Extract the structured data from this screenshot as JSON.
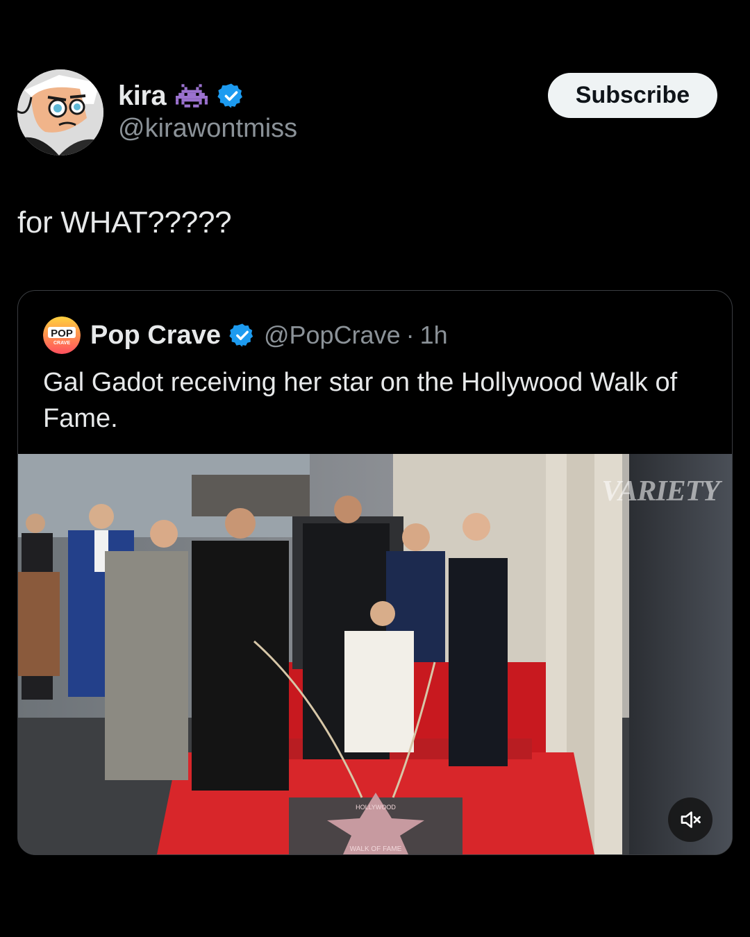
{
  "post": {
    "author": {
      "display_name": "kira",
      "handle": "@kirawontmiss",
      "name_emoji_icon": "space-invader-icon",
      "verified_icon": "verified-badge-icon"
    },
    "subscribe_label": "Subscribe",
    "text": "for WHAT?????"
  },
  "quote": {
    "author": {
      "display_name": "Pop Crave",
      "handle": "@PopCrave",
      "separator": "·",
      "time": "1h",
      "avatar_text_top": "POP",
      "avatar_text_bottom": "CRAVE",
      "verified_icon": "verified-badge-icon"
    },
    "text": "Gal Gadot receiving her star on the Hollywood Walk of Fame.",
    "media": {
      "type": "video",
      "watermark": "VARIETY",
      "star_text_top": "HOLLYWOOD",
      "star_text_bottom": "WALK OF FAME",
      "mute_icon": "speaker-muted-icon"
    }
  },
  "colors": {
    "background": "#000000",
    "primary_text": "#e7e9ea",
    "secondary_text": "#8b9298",
    "verified_blue": "#1d9bf0",
    "emoji_purple": "#9b72cf",
    "button_bg": "#eff3f4",
    "carpet_red": "#d8262a"
  }
}
